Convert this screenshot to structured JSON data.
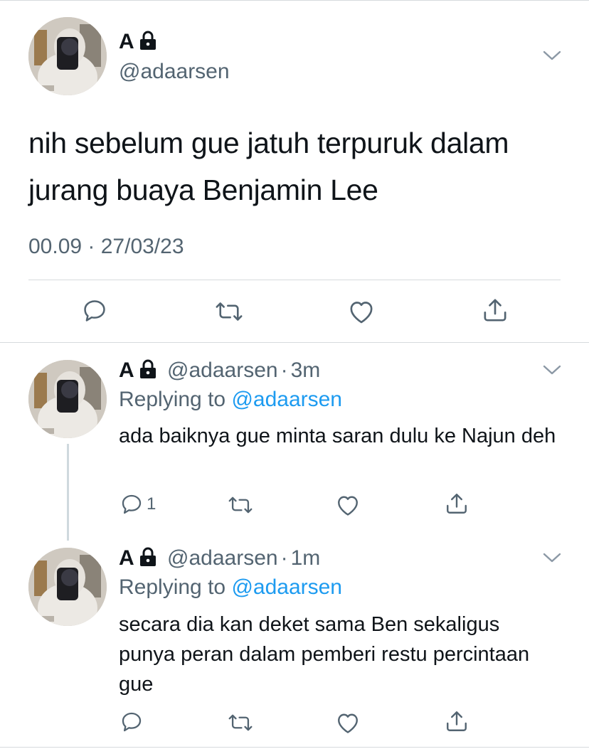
{
  "main_tweet": {
    "name": "A",
    "handle": "@adaarsen",
    "text": "nih sebelum gue jatuh terpuruk dalam jurang buaya Benjamin Lee",
    "timestamp": "00.09 · 27/03/23"
  },
  "replies": [
    {
      "name": "A",
      "handle": "@adaarsen",
      "separator": "·",
      "time": "3m",
      "replying_prefix": "Replying to",
      "replying_to": "@adaarsen",
      "text": "ada baiknya gue minta saran dulu ke Najun deh",
      "reply_count": "1"
    },
    {
      "name": "A",
      "handle": "@adaarsen",
      "separator": "·",
      "time": "1m",
      "replying_prefix": "Replying to",
      "replying_to": "@adaarsen",
      "text": "secara dia kan deket sama Ben sekaligus punya peran dalam pemberi restu percintaan gue",
      "reply_count": ""
    }
  ],
  "icons": {
    "lock": "lock-icon",
    "chevron": "chevron-down-icon",
    "reply": "reply-icon",
    "retweet": "retweet-icon",
    "like": "like-icon",
    "share": "share-icon"
  },
  "colors": {
    "text": "#0f1419",
    "secondary": "#536471",
    "link": "#1d9bf0",
    "divider": "#d6dadd"
  }
}
